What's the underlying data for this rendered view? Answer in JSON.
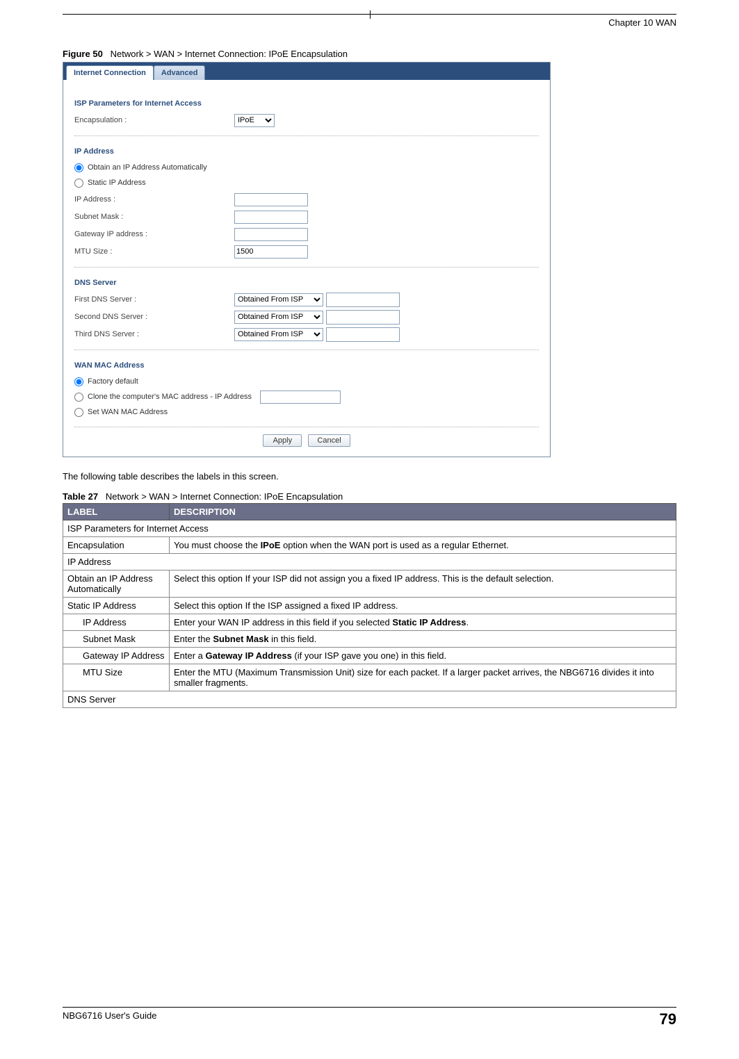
{
  "header": {
    "chapter": "Chapter 10 WAN"
  },
  "figure": {
    "label": "Figure 50",
    "caption": "Network > WAN > Internet Connection: IPoE Encapsulation"
  },
  "screenshot": {
    "tabs": {
      "active": "Internet Connection",
      "other": "Advanced"
    },
    "isp_section": {
      "title": "ISP Parameters for Internet Access",
      "encaps_label": "Encapsulation :",
      "encaps_value": "IPoE"
    },
    "ip_section": {
      "title": "IP Address",
      "radio_auto": "Obtain an IP Address Automatically",
      "radio_static": "Static IP Address",
      "ip_label": "IP Address :",
      "ip_value": "",
      "subnet_label": "Subnet Mask :",
      "subnet_value": "",
      "gw_label": "Gateway IP address :",
      "gw_value": "",
      "mtu_label": "MTU Size :",
      "mtu_value": "1500"
    },
    "dns_section": {
      "title": "DNS Server",
      "first_label": "First DNS Server :",
      "second_label": "Second DNS Server :",
      "third_label": "Third DNS Server :",
      "option": "Obtained From ISP"
    },
    "mac_section": {
      "title": "WAN MAC Address",
      "radio_factory": "Factory default",
      "radio_clone": "Clone the computer's MAC address - IP Address",
      "radio_set": "Set WAN MAC Address"
    },
    "buttons": {
      "apply": "Apply",
      "cancel": "Cancel"
    }
  },
  "intro_text": "The following table describes the labels in this screen.",
  "table": {
    "label": "Table 27",
    "caption": "Network > WAN > Internet Connection: IPoE Encapsulation",
    "head_label": "LABEL",
    "head_desc": "DESCRIPTION",
    "rows": [
      {
        "span": true,
        "label": "ISP Parameters for Internet Access"
      },
      {
        "label": "Encapsulation",
        "desc_pre": "You must choose the ",
        "desc_b": "IPoE",
        "desc_post": " option when the WAN port is used as a regular Ethernet."
      },
      {
        "span": true,
        "label": "IP Address"
      },
      {
        "label": "Obtain an IP Address Automatically",
        "desc": "Select this option If your ISP did not assign you a fixed IP address. This is the default selection."
      },
      {
        "label": "Static IP Address",
        "desc": "Select this option If the ISP assigned a fixed IP address."
      },
      {
        "indent": true,
        "label": "IP Address",
        "desc_pre": "Enter your WAN IP address in this field if you selected ",
        "desc_b": "Static IP Address",
        "desc_post": "."
      },
      {
        "indent": true,
        "label": "Subnet Mask",
        "desc_pre": "Enter the ",
        "desc_b": "Subnet Mask",
        "desc_post": " in this field."
      },
      {
        "indent": true,
        "label": "Gateway IP Address",
        "desc_pre": "Enter a ",
        "desc_b": "Gateway IP Address",
        "desc_post": " (if your ISP gave you one) in this field."
      },
      {
        "indent": true,
        "label": "MTU Size",
        "desc": "Enter the MTU (Maximum Transmission Unit) size for each packet. If a larger packet arrives, the NBG6716 divides it into smaller fragments."
      },
      {
        "span": true,
        "label": "DNS Server"
      }
    ]
  },
  "footer": {
    "guide": "NBG6716 User's Guide",
    "page": "79"
  }
}
